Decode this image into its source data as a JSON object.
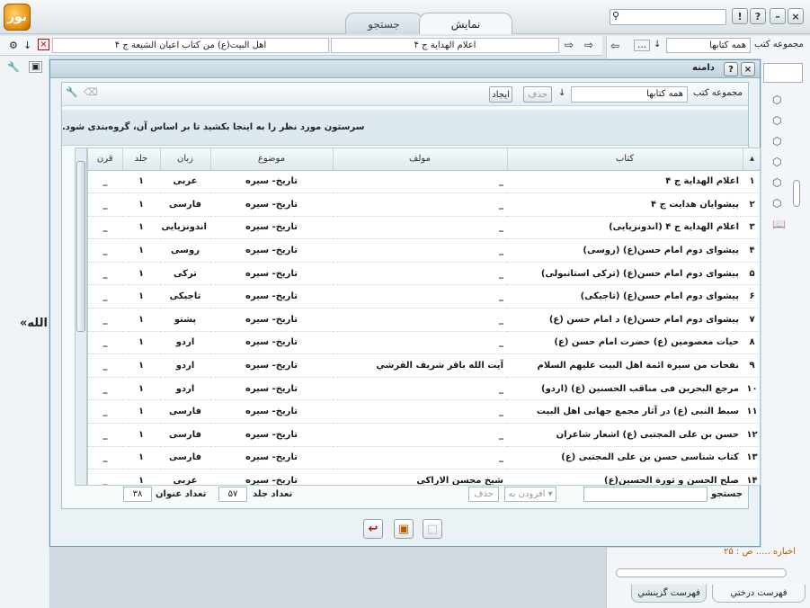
{
  "app": {
    "logo_text": "نور",
    "tabs": [
      "نمایش",
      "جستجو"
    ],
    "window_buttons": [
      "×",
      "–",
      "?",
      "!"
    ]
  },
  "nav": {
    "book_field": "اعلام الهداية ج ۴",
    "book_field2": "اهل البيت(ع) من كتاب اعيان الشيعة ج ۴",
    "collection_label": "مجموعه كتب",
    "collection_value": "همه كتابها"
  },
  "side_text": "الله»",
  "right_panel": {
    "page_ref": "اخباره ..... ص : ۲۵",
    "tabs": [
      "فهرست درختي",
      "فهرست گزينشي"
    ]
  },
  "dialog": {
    "title": "دامنه",
    "collection_label": "مجموعه كتب",
    "collection_value": "همه كتابها",
    "btn_delete": "حذف",
    "btn_create": "ايجاد",
    "group_hint": "سرستون مورد نظر را به اينجا بكشيد تا بر اساس آن، گروه‌بندی شود.",
    "columns": {
      "num": "",
      "book": "كتاب",
      "author": "مولف",
      "subject": "موضوع",
      "language": "زبان",
      "volume": "جلد",
      "century": "قرن"
    },
    "rows": [
      {
        "n": "۱",
        "book": "اعلام الهداية ج ۴",
        "author": "_",
        "subject": "تاريخ- سيره",
        "lang": "عربی",
        "vol": "۱",
        "cent": "_"
      },
      {
        "n": "۲",
        "book": "پيشوايان هدايت ج ۴",
        "author": "_",
        "subject": "تاريخ- سيره",
        "lang": "فارسی",
        "vol": "۱",
        "cent": "_"
      },
      {
        "n": "۳",
        "book": "اعلام الهداية ج ۴ (اندونزيايی)",
        "author": "_",
        "subject": "تاريخ- سيره",
        "lang": "اندونزيايی",
        "vol": "۱",
        "cent": "_"
      },
      {
        "n": "۴",
        "book": "پيشوای دوم امام حسن(ع) (روسی)",
        "author": "_",
        "subject": "تاريخ- سيره",
        "lang": "روسی",
        "vol": "۱",
        "cent": "_"
      },
      {
        "n": "۵",
        "book": "پيشوای دوم امام حسن(ع) (تركی استانبولی)",
        "author": "_",
        "subject": "تاريخ- سيره",
        "lang": "تركی",
        "vol": "۱",
        "cent": "_"
      },
      {
        "n": "۶",
        "book": "پيشوای دوم امام حسن(ع) (تاجيكی)",
        "author": "_",
        "subject": "تاريخ- سيره",
        "lang": "تاجيكی",
        "vol": "۱",
        "cent": "_"
      },
      {
        "n": "۷",
        "book": "پيشوای دوم امام حسن(ع) د امام حسن (ع)",
        "author": "_",
        "subject": "تاريخ- سيره",
        "lang": "پشتو",
        "vol": "۱",
        "cent": "_"
      },
      {
        "n": "۸",
        "book": "حيات معصومين (ع) حضرت امام حسن (ع)",
        "author": "_",
        "subject": "تاريخ- سيره",
        "lang": "اردو",
        "vol": "۱",
        "cent": "_"
      },
      {
        "n": "۹",
        "book": "نفحات من سيرة ائمة اهل البيت عليهم السلام",
        "author": "آيت الله باقر شريف القرشي",
        "subject": "تاريخ- سيره",
        "lang": "اردو",
        "vol": "۱",
        "cent": "_"
      },
      {
        "n": "۱۰",
        "book": "مرجع البحرين فی مناقب الحسنين (ع) (اردو)",
        "author": "_",
        "subject": "تاريخ- سيره",
        "lang": "اردو",
        "vol": "۱",
        "cent": "_"
      },
      {
        "n": "۱۱",
        "book": "سبط النبی (ع) در آثار مجمع جهانی اهل البيت",
        "author": "_",
        "subject": "تاريخ- سيره",
        "lang": "فارسی",
        "vol": "۱",
        "cent": "_"
      },
      {
        "n": "۱۲",
        "book": "حسن بن علی المجتبی (ع) اشعار شاعران",
        "author": "_",
        "subject": "تاريخ- سيره",
        "lang": "فارسی",
        "vol": "۱",
        "cent": "_"
      },
      {
        "n": "۱۳",
        "book": "كتاب شناسی حسن بن علی المجتبی (ع)",
        "author": "_",
        "subject": "تاريخ- سيره",
        "lang": "فارسی",
        "vol": "۱",
        "cent": "_"
      },
      {
        "n": "۱۴",
        "book": "صلح الحسن و ثورة الحسين(ع)",
        "author": "شيخ محسن الاراكی",
        "subject": "تاريخ- سيره",
        "lang": "عربی",
        "vol": "۱",
        "cent": "_"
      }
    ],
    "footer": {
      "search_label": "جستجو",
      "add_to": "افزودن به",
      "delete": "حذف",
      "vol_count_label": "تعداد جلد",
      "vol_count": "۵۷",
      "title_count_label": "تعداد عنوان",
      "title_count": "۳۸"
    }
  },
  "colors": {
    "accent": "#6f98ad",
    "header_bg": "#dde9ef",
    "logo": "#e58b0c"
  }
}
